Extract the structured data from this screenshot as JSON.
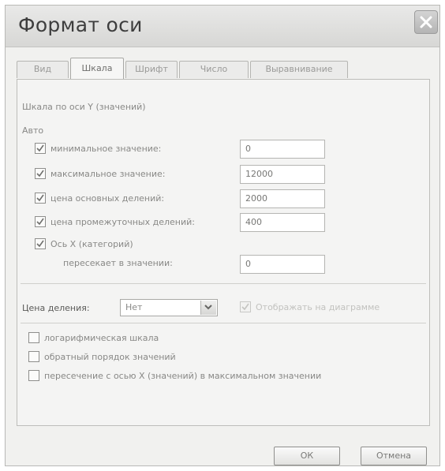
{
  "dialog": {
    "title": "Формат оси",
    "ok_label": "ОК",
    "cancel_label": "Отмена"
  },
  "tabs": [
    {
      "label": "Вид",
      "active": false
    },
    {
      "label": "Шкала",
      "active": true
    },
    {
      "label": "Шрифт",
      "active": false
    },
    {
      "label": "Число",
      "active": false
    },
    {
      "label": "Выравнивание",
      "active": false
    }
  ],
  "scale": {
    "heading": "Шкала по оси Y (значений)",
    "auto_label": "Авто",
    "rows": [
      {
        "label": "минимальное значение:",
        "checked": true,
        "value": "0"
      },
      {
        "label": "максимальное значение:",
        "checked": true,
        "value": "12000"
      },
      {
        "label": "цена основных делений:",
        "checked": true,
        "value": "2000"
      },
      {
        "label": "цена промежуточных делений:",
        "checked": true,
        "value": "400"
      }
    ],
    "axis_x": {
      "label": "Ось X (категорий)",
      "checked": true,
      "crosses_label": "пересекает в значении:",
      "value": "0"
    }
  },
  "division": {
    "label": "Цена деления:",
    "selected": "Нет",
    "display_label": "Отображать на диаграмме",
    "display_checked": true
  },
  "options": [
    {
      "label": "логарифмическая шкала",
      "checked": false
    },
    {
      "label": "обратный порядок значений",
      "checked": false
    },
    {
      "label": "пересечение с осью X (значений) в максимальном значении",
      "checked": false
    }
  ],
  "colors": {
    "window_bg": "#f1f1ef",
    "border": "#b9b9b6",
    "text_muted": "#888886"
  }
}
